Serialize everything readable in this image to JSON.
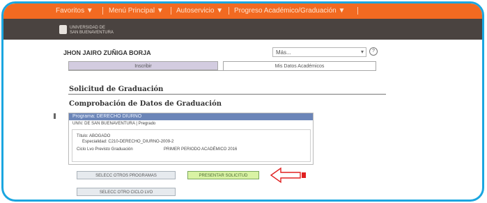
{
  "top_menu": [
    {
      "label": "Favoritos ▼"
    },
    {
      "label": "Menú Principal ▼"
    },
    {
      "label": "Autoservicio ▼"
    },
    {
      "label": "Progreso Académico/Graduación ▼"
    }
  ],
  "logo": {
    "line1": "UNIVERSIDAD DE",
    "line2": "SAN BUENAVENTURA"
  },
  "user": {
    "name": "JHON JAIRO ZUÑIGA BORJA"
  },
  "dropdown": {
    "value": "Más..."
  },
  "tabs": {
    "inactive": "Inscribir",
    "active": "Mis Datos Académicos"
  },
  "section_title": "Solicitud de Graduación",
  "subsection_title": "Comprobación de Datos de Graduación",
  "program": {
    "header": "Programa: DERECHO DIURNO",
    "institution": "UNIV. DE SAN BUENAVENTURA | Pregrado",
    "title": "Título: ABOGADO",
    "specialty": "Especialidad: C210-DERECHO_DIURNO-2009-2",
    "cycle_label": "Ciclo Lvo Previsto Graduación",
    "cycle_value": "PRIMER PERIODO ACADÉMICO 2016"
  },
  "buttons": {
    "select_other_programs": "SELECC OTROS PROGRAMAS",
    "submit_request": "PRESENTAR SOLICITUD",
    "select_other_cycle": "SELECC OTRO CICLO LVO"
  },
  "colors": {
    "frame": "#1aa6e0",
    "topbar": "#f26a21",
    "header": "#4a4340",
    "program_header": "#6b85b8",
    "submit_button": "#d9f3a4",
    "arrow": "#e02020"
  }
}
